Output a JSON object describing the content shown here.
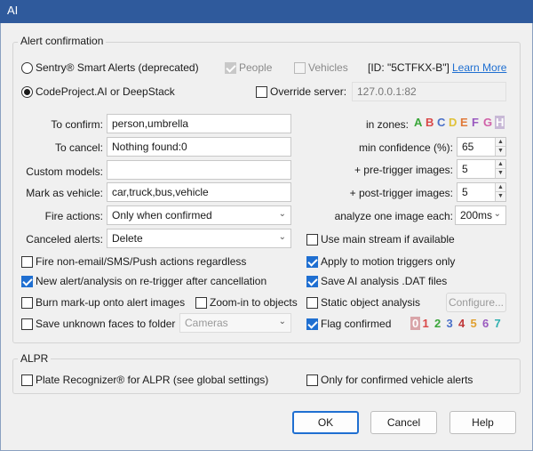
{
  "window": {
    "title": "AI"
  },
  "alert_confirmation": {
    "legend": "Alert confirmation",
    "sentry_label": "Sentry® Smart Alerts (deprecated)",
    "people_label": "People",
    "vehicles_label": "Vehicles",
    "id_text": "[ID: \"5CTFKX-B\"]",
    "learn_more": "Learn More",
    "codeproject_label": "CodeProject.AI or DeepStack",
    "override_label": "Override server:",
    "override_value": "127.0.0.1:82",
    "to_confirm_label": "To confirm:",
    "to_confirm_value": "person,umbrella",
    "to_cancel_label": "To cancel:",
    "to_cancel_value": "Nothing found:0",
    "custom_models_label": "Custom models:",
    "custom_models_value": "",
    "mark_vehicle_label": "Mark as vehicle:",
    "mark_vehicle_value": "car,truck,bus,vehicle",
    "fire_actions_label": "Fire actions:",
    "fire_actions_value": "Only when confirmed",
    "canceled_alerts_label": "Canceled alerts:",
    "canceled_alerts_value": "Delete",
    "in_zones_label": "in zones:",
    "zones": [
      {
        "letter": "A",
        "color": "#3aa63a"
      },
      {
        "letter": "B",
        "color": "#d94848"
      },
      {
        "letter": "C",
        "color": "#4a70c8"
      },
      {
        "letter": "D",
        "color": "#e0c23a"
      },
      {
        "letter": "E",
        "color": "#e07a3a"
      },
      {
        "letter": "F",
        "color": "#9a5abf"
      },
      {
        "letter": "G",
        "color": "#d060a8"
      },
      {
        "letter": "H",
        "color": "#c8b9d6"
      }
    ],
    "min_confidence_label": "min confidence (%):",
    "min_confidence_value": "65",
    "pre_trigger_label": "+ pre-trigger images:",
    "pre_trigger_value": "5",
    "post_trigger_label": "+ post-trigger images:",
    "post_trigger_value": "5",
    "analyze_each_label": "analyze one image each:",
    "analyze_each_value": "200ms",
    "use_main_stream_label": "Use main stream if available",
    "fire_nonemail_label": "Fire non-email/SMS/Push actions regardless",
    "apply_motion_label": "Apply to motion triggers only",
    "new_alert_label": "New alert/analysis on re-trigger after cancellation",
    "save_dat_label": "Save AI analysis .DAT files",
    "burn_markup_label": "Burn mark-up onto alert images",
    "zoom_in_label": "Zoom-in to objects",
    "static_object_label": "Static object analysis",
    "configure_label": "Configure...",
    "save_faces_label": "Save unknown faces to folder",
    "faces_folder_value": "Cameras",
    "flag_confirmed_label": "Flag confirmed",
    "flags": [
      {
        "digit": "0",
        "color": "#d9a5a9"
      },
      {
        "digit": "1",
        "color": "#d94848"
      },
      {
        "digit": "2",
        "color": "#3aa63a"
      },
      {
        "digit": "3",
        "color": "#4a70c8"
      },
      {
        "digit": "4",
        "color": "#c0383a"
      },
      {
        "digit": "5",
        "color": "#e0a030"
      },
      {
        "digit": "6",
        "color": "#9a5abf"
      },
      {
        "digit": "7",
        "color": "#30b0b0"
      }
    ]
  },
  "alpr": {
    "legend": "ALPR",
    "plate_label": "Plate Recognizer® for ALPR (see global settings)",
    "only_confirmed_label": "Only for confirmed vehicle alerts"
  },
  "buttons": {
    "ok": "OK",
    "cancel": "Cancel",
    "help": "Help"
  }
}
